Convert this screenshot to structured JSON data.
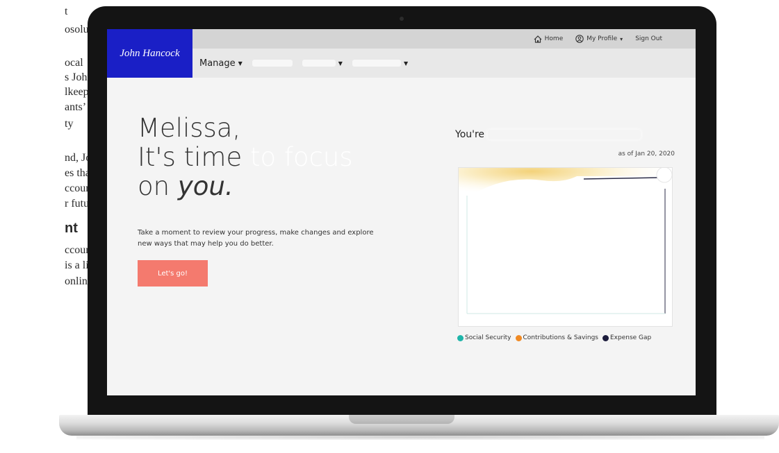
{
  "article": {
    "lines": [
      "t",
      "osolutely",
      "ocal",
      "s John",
      "lkeeper,",
      "ants’",
      "ty",
      "nd, John",
      "es that",
      "ccount",
      "r future."
    ],
    "heading": "nt",
    "lines2": [
      "ccount",
      "is a list",
      "online"
    ]
  },
  "header": {
    "logo": "John Hancock",
    "links": {
      "home": "Home",
      "profile": "My Profile",
      "signout": "Sign Out"
    },
    "nav": {
      "manage": "Manage"
    }
  },
  "hero": {
    "line1": "Melissa,",
    "line2": "It's time",
    "line2_ghost": "to focus",
    "line3a": "on",
    "line3b": "you.",
    "subtext": "Take a moment to review your progress, make changes and explore new ways that may help you do better.",
    "cta": "Let's go!"
  },
  "panel": {
    "prefix": "You're",
    "as_of": "as of Jan 20, 2020",
    "legend": [
      {
        "label": "Social Security",
        "color": "#1fb5a9"
      },
      {
        "label": "Contributions & Savings",
        "color": "#f08a24"
      },
      {
        "label": "Expense Gap",
        "color": "#1c1c3c"
      }
    ]
  },
  "colors": {
    "brand_blue": "#1a1fc6",
    "cta": "#f47a6e"
  }
}
